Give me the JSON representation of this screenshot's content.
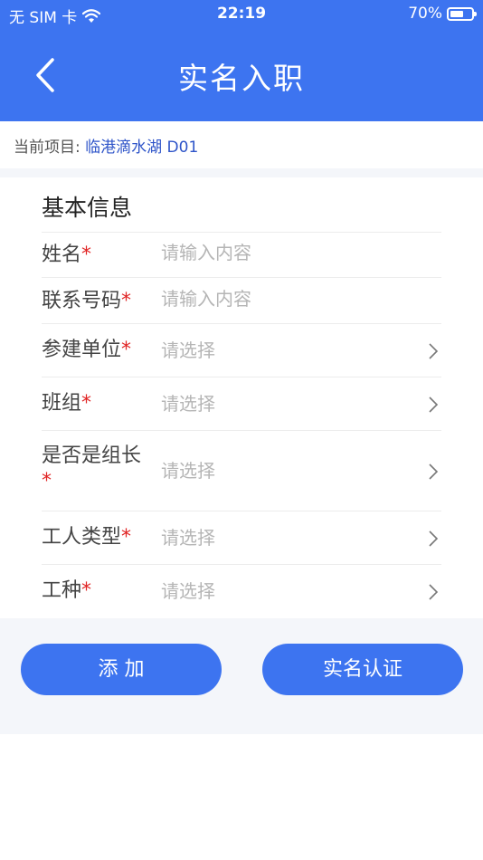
{
  "status_bar": {
    "carrier": "无 SIM 卡",
    "time": "22:19",
    "battery": "70%",
    "battery_level": 0.7
  },
  "nav": {
    "title": "实名入职"
  },
  "project": {
    "label": "当前项目:",
    "value": "临港滴水湖 D01"
  },
  "form": {
    "section_title": "基本信息",
    "required_mark": "*",
    "rows": [
      {
        "label": "姓名",
        "value": "请输入内容"
      },
      {
        "label": "联系号码",
        "value": "请输入内容"
      },
      {
        "label": "参建单位",
        "value": "请选择"
      },
      {
        "label": "班组",
        "value": "请选择"
      },
      {
        "label": "是否是组长",
        "value": "请选择"
      },
      {
        "label": "工人类型",
        "value": "请选择"
      },
      {
        "label": "工种",
        "value": "请选择"
      }
    ]
  },
  "buttons": {
    "add": "添 加",
    "verify": "实名认证"
  },
  "colors": {
    "primary": "#3d74f0",
    "required": "#e02424",
    "project_value": "#2f55c9"
  }
}
